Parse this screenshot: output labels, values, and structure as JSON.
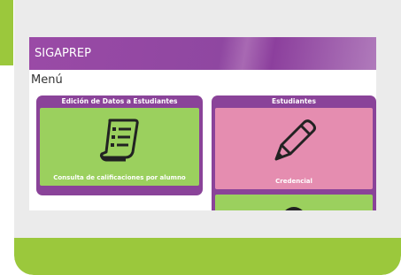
{
  "app": {
    "title": "SIGAPREP"
  },
  "menu": {
    "title": "Menú"
  },
  "panels": [
    {
      "header": "Edición de Datos a Estudiantes",
      "tiles": [
        {
          "label": "Consulta de calificaciones por alumno",
          "icon": "document-list-icon",
          "color": "#9bd05e"
        }
      ]
    },
    {
      "header": "Estudiantes",
      "tiles": [
        {
          "label": "Credencial",
          "icon": "pencil-icon",
          "color": "#e58db0"
        },
        {
          "label": "",
          "icon": "partial-icon",
          "color": "#9bd05e"
        }
      ]
    }
  ],
  "colors": {
    "brand_purple": "#8a4399",
    "accent_green": "#9bc83c",
    "tile_green": "#9bd05e",
    "tile_pink": "#e58db0",
    "card_gray": "#ebebeb"
  }
}
